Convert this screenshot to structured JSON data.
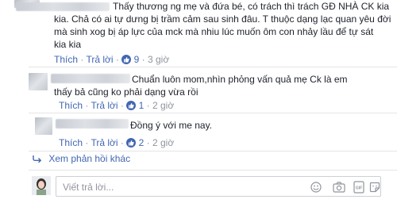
{
  "comments": [
    {
      "text": "Thấy thương ng mẹ và đứa bé, có trách thì trách GĐ NHÀ CK kia kia. Chả có ai tự dưng bị trầm cảm sau sinh đâu. T thuộc dạng lạc quan yêu đời mà sinh xog bị áp lực của mck mà nhiu lúc muốn ôm con nhảy lầu để tự sát kia kia",
      "line1": "Thấy thương ng mẹ và đứa bé, có trách thì trách GĐ NHÀ CK kia",
      "line2": "kia. Chả có ai tự dưng bị trầm cảm sau sinh đâu. T thuộc dạng lạc quan yêu đời",
      "line3": "mà sinh xog bị áp lực của mck mà nhiu lúc muốn ôm con nhảy lầu để tự sát",
      "line4": "kia kia",
      "like_label": "Thích",
      "reply_label": "Trả lời",
      "likes": "9",
      "time": "3 giờ",
      "sep": "·"
    },
    {
      "line1": "Chuẩn luôn mom,nhìn phỏng vấn quả mẹ Ck là em",
      "line2": "thấy bả cũng ko phải dạng vừa rồi",
      "like_label": "Thích",
      "reply_label": "Trả lời",
      "likes": "1",
      "time": "2 giờ",
      "sep": "·"
    },
    {
      "line1": "Đồng ý với me nay.",
      "like_label": "Thích",
      "reply_label": "Trả lời",
      "likes": "2",
      "time": "2 giờ",
      "sep": "·"
    }
  ],
  "more_replies": "Xem phản hồi khác",
  "reply_box": {
    "placeholder": "Viết trả lời..."
  },
  "colors": {
    "link": "#4267b2",
    "meta": "#90949c",
    "text": "#1d2129"
  },
  "icons": [
    "reply-arrow-icon",
    "emoji-icon",
    "camera-icon",
    "gif-icon",
    "sticker-icon",
    "like-badge-icon"
  ]
}
